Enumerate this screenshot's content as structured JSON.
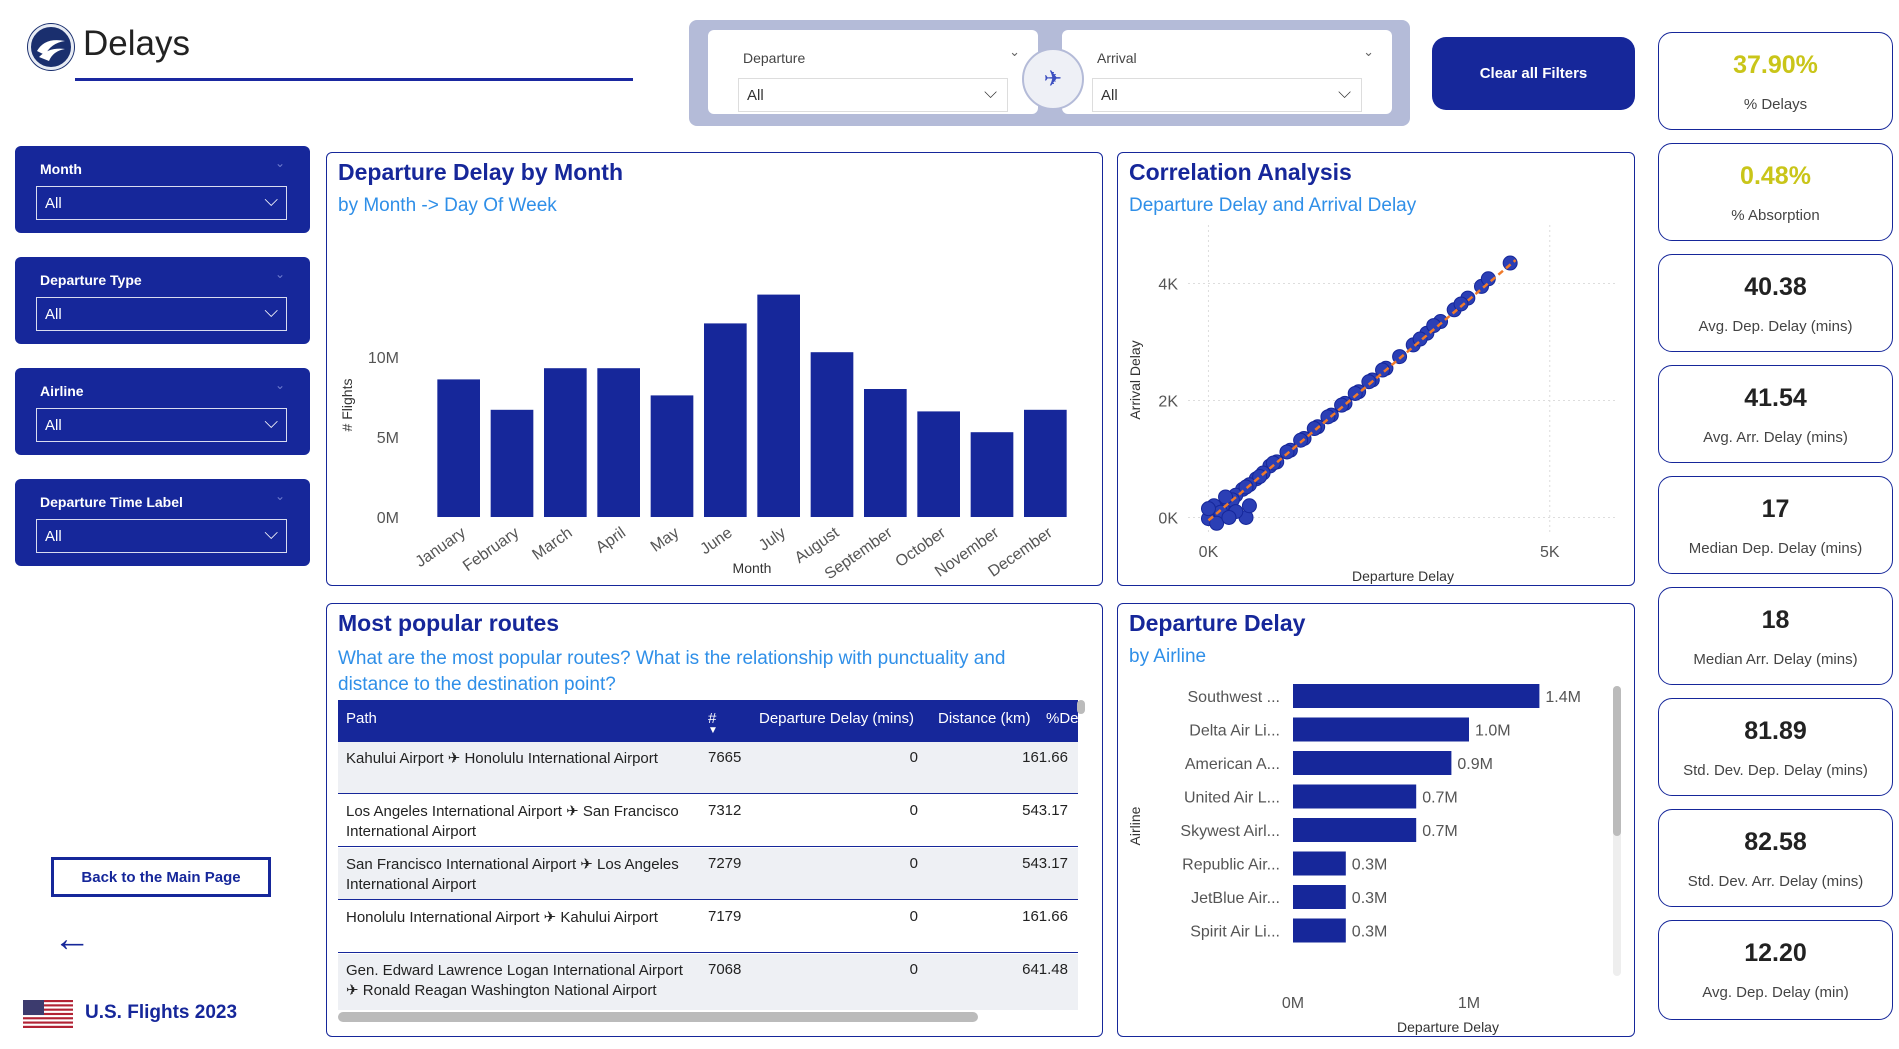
{
  "header": {
    "title": "Delays"
  },
  "top_filters": {
    "departure": {
      "label": "Departure",
      "value": "All"
    },
    "arrival": {
      "label": "Arrival",
      "value": "All"
    },
    "clear_label": "Clear all Filters"
  },
  "slicers": [
    {
      "label": "Month",
      "value": "All"
    },
    {
      "label": "Departure Type",
      "value": "All"
    },
    {
      "label": "Airline",
      "value": "All"
    },
    {
      "label": "Departure Time Label",
      "value": "All"
    }
  ],
  "nav": {
    "back_label": "Back to the Main Page",
    "back_arrow": "←"
  },
  "footer": {
    "title": "U.S. Flights 2023"
  },
  "kpis": [
    {
      "value": "37.90%",
      "label": "% Delays",
      "color": "#c9c519"
    },
    {
      "value": "0.48%",
      "label": "% Absorption",
      "color": "#c9c519"
    },
    {
      "value": "40.38",
      "label": "Avg. Dep. Delay (mins)"
    },
    {
      "value": "41.54",
      "label": "Avg. Arr. Delay (mins)"
    },
    {
      "value": "17",
      "label": "Median Dep. Delay (mins)"
    },
    {
      "value": "18",
      "label": "Median Arr. Delay (mins)"
    },
    {
      "value": "81.89",
      "label": "Std. Dev. Dep. Delay (mins)"
    },
    {
      "value": "82.58",
      "label": "Std. Dev. Arr. Delay (mins)"
    },
    {
      "value": "12.20",
      "label": "Avg. Dep. Delay (min)"
    }
  ],
  "panels": {
    "month": {
      "title": "Departure Delay by Month",
      "subtitle": "by Month -> Day Of Week"
    },
    "correlation": {
      "title": "Correlation Analysis",
      "subtitle": "Departure Delay and Arrival Delay"
    },
    "routes": {
      "title": "Most popular routes",
      "subtitle": "What are the most popular routes? What is the relationship with punctuality and distance to the destination point?"
    },
    "airline": {
      "title": "Departure Delay",
      "subtitle": "by Airline"
    }
  },
  "routes_table": {
    "columns": [
      "Path",
      "#",
      "Departure Delay (mins)",
      "Distance (km)",
      "%De"
    ],
    "rows": [
      {
        "path": "Kahului Airport ✈ Honolulu International Airport",
        "count": "7665",
        "delay": "0",
        "distance": "161.66"
      },
      {
        "path": "Los Angeles International Airport ✈ San Francisco International Airport",
        "count": "7312",
        "delay": "0",
        "distance": "543.17"
      },
      {
        "path": "San Francisco International Airport ✈ Los Angeles International Airport",
        "count": "7279",
        "delay": "0",
        "distance": "543.17"
      },
      {
        "path": "Honolulu International Airport ✈ Kahului Airport",
        "count": "7179",
        "delay": "0",
        "distance": "161.66"
      },
      {
        "path": "Gen. Edward Lawrence Logan International Airport ✈ Ronald Reagan Washington National Airport",
        "count": "7068",
        "delay": "0",
        "distance": "641.48"
      }
    ]
  },
  "chart_data": [
    {
      "type": "bar",
      "title": "Departure Delay by Month",
      "subtitle": "by Month -> Day Of Week",
      "xlabel": "Month",
      "ylabel": "# Flights",
      "categories": [
        "January",
        "February",
        "March",
        "April",
        "May",
        "June",
        "July",
        "August",
        "September",
        "October",
        "November",
        "December"
      ],
      "values": [
        8.6,
        6.7,
        9.3,
        9.3,
        7.6,
        12.1,
        13.9,
        10.3,
        8.0,
        6.6,
        5.3,
        6.7
      ],
      "value_unit": "M",
      "ylim": [
        0,
        14.5
      ],
      "yticks": [
        "0M",
        "5M",
        "10M"
      ],
      "color": "#16279a"
    },
    {
      "type": "scatter",
      "title": "Correlation Analysis",
      "subtitle": "Departure Delay and Arrival Delay",
      "xlabel": "Departure Delay",
      "ylabel": "Arrival Delay",
      "xticks": [
        "0K",
        "5K"
      ],
      "yticks": [
        "0K",
        "2K",
        "4K"
      ],
      "xlim": [
        -300,
        6000
      ],
      "ylim": [
        -300,
        5000
      ],
      "points": [
        [
          4420,
          4350
        ],
        [
          2800,
          2750
        ],
        [
          3000,
          2950
        ],
        [
          3200,
          3150
        ],
        [
          3400,
          3350
        ],
        [
          3600,
          3550
        ],
        [
          3800,
          3750
        ],
        [
          4000,
          3950
        ],
        [
          2600,
          2550
        ],
        [
          2400,
          2350
        ],
        [
          2200,
          2150
        ],
        [
          2000,
          1950
        ],
        [
          1800,
          1750
        ],
        [
          1600,
          1550
        ],
        [
          1400,
          1350
        ],
        [
          1200,
          1150
        ],
        [
          1000,
          950
        ],
        [
          900,
          880
        ],
        [
          800,
          760
        ],
        [
          700,
          660
        ],
        [
          600,
          560
        ],
        [
          500,
          480
        ],
        [
          400,
          380
        ],
        [
          300,
          260
        ],
        [
          200,
          180
        ],
        [
          100,
          80
        ],
        [
          50,
          20
        ],
        [
          0,
          -20
        ],
        [
          150,
          120
        ],
        [
          350,
          300
        ],
        [
          550,
          520
        ],
        [
          750,
          700
        ],
        [
          950,
          930
        ],
        [
          1150,
          1120
        ],
        [
          1350,
          1320
        ],
        [
          1550,
          1520
        ],
        [
          1750,
          1720
        ],
        [
          1950,
          1920
        ],
        [
          2150,
          2120
        ],
        [
          2350,
          2320
        ],
        [
          2550,
          2520
        ],
        [
          3100,
          3050
        ],
        [
          3300,
          3280
        ],
        [
          3700,
          3650
        ],
        [
          4100,
          4080
        ],
        [
          550,
          0
        ],
        [
          400,
          100
        ],
        [
          250,
          350
        ],
        [
          600,
          200
        ],
        [
          80,
          200
        ],
        [
          180,
          90
        ],
        [
          120,
          -100
        ],
        [
          300,
          0
        ],
        [
          0,
          150
        ]
      ],
      "trendline": [
        [
          0,
          -50
        ],
        [
          4500,
          4400
        ]
      ],
      "color": "#16279a",
      "trend_color": "#f07a2a"
    },
    {
      "type": "bar",
      "orientation": "horizontal",
      "title": "Departure Delay",
      "subtitle": "by Airline",
      "xlabel": "Departure Delay",
      "ylabel": "Airline",
      "categories": [
        "Southwest ...",
        "Delta Air Li...",
        "American A...",
        "United Air L...",
        "Skywest Airl...",
        "Republic Air...",
        "JetBlue Air...",
        "Spirit Air Li..."
      ],
      "values": [
        1.4,
        1.0,
        0.9,
        0.7,
        0.7,
        0.3,
        0.3,
        0.3
      ],
      "labels": [
        "1.4M",
        "1.0M",
        "0.9M",
        "0.7M",
        "0.7M",
        "0.3M",
        "0.3M",
        "0.3M"
      ],
      "xticks": [
        "0M",
        "1M"
      ],
      "xlim": [
        0,
        1.75
      ],
      "color": "#16279a"
    }
  ]
}
